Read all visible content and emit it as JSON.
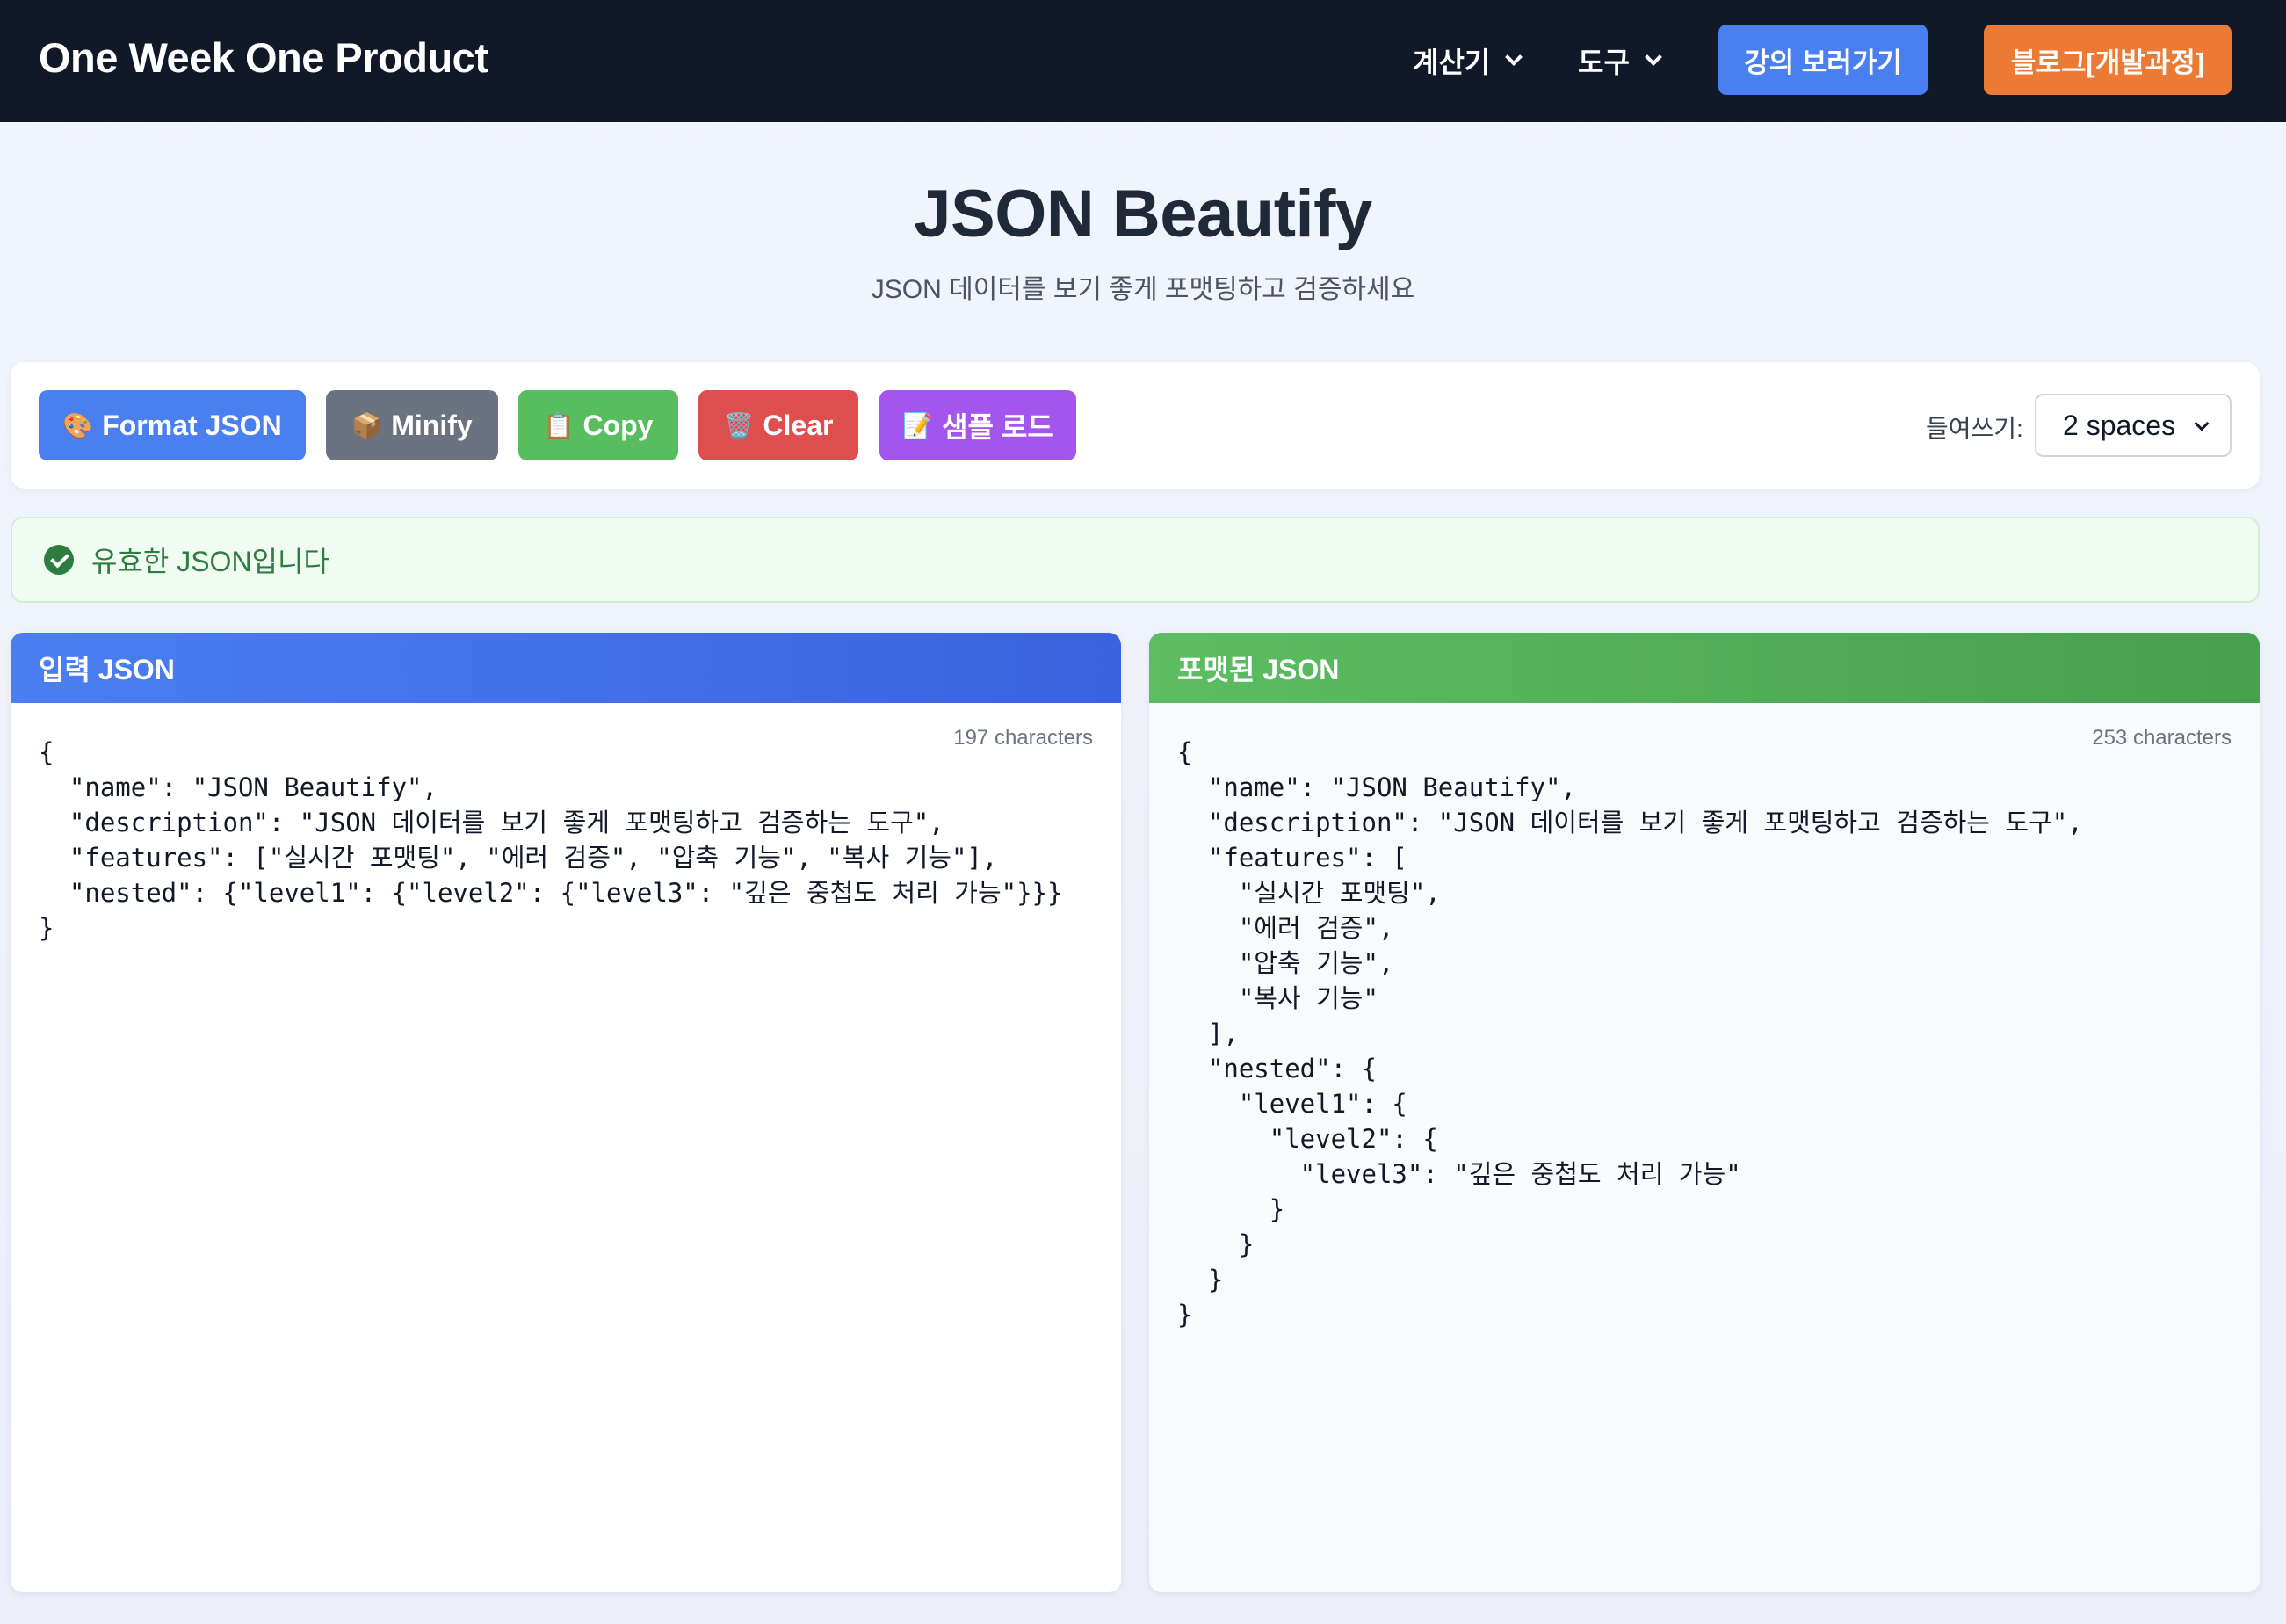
{
  "navbar": {
    "brand": "One Week One Product",
    "menu": [
      {
        "label": "계산기"
      },
      {
        "label": "도구"
      }
    ],
    "lecture_button": "강의 보러가기",
    "blog_button": "블로그[개발과정]"
  },
  "header": {
    "title": "JSON Beautify",
    "subtitle": "JSON 데이터를 보기 좋게 포맷팅하고 검증하세요"
  },
  "toolbar": {
    "buttons": [
      {
        "emoji": "🎨",
        "label": "Format JSON"
      },
      {
        "emoji": "📦",
        "label": "Minify"
      },
      {
        "emoji": "📋",
        "label": "Copy"
      },
      {
        "emoji": "🗑️",
        "label": "Clear"
      },
      {
        "emoji": "📝",
        "label": "샘플 로드"
      }
    ],
    "indent_label": "들여쓰기:",
    "indent_value": "2 spaces"
  },
  "status": {
    "message": "유효한 JSON입니다",
    "color": "#2e7d40"
  },
  "input_panel": {
    "title": "입력 JSON",
    "char_count": "197 characters",
    "content": "{\n  \"name\": \"JSON Beautify\",\n  \"description\": \"JSON 데이터를 보기 좋게 포맷팅하고 검증하는 도구\",\n  \"features\": [\"실시간 포맷팅\", \"에러 검증\", \"압축 기능\", \"복사 기능\"],\n  \"nested\": {\"level1\": {\"level2\": {\"level3\": \"깊은 중첩도 처리 가능\"}}}\n}"
  },
  "output_panel": {
    "title": "포맷된 JSON",
    "char_count": "253 characters",
    "content": "{\n  \"name\": \"JSON Beautify\",\n  \"description\": \"JSON 데이터를 보기 좋게 포맷팅하고 검증하는 도구\",\n  \"features\": [\n    \"실시간 포맷팅\",\n    \"에러 검증\",\n    \"압축 기능\",\n    \"복사 기능\"\n  ],\n  \"nested\": {\n    \"level1\": {\n      \"level2\": {\n        \"level3\": \"깊은 중첩도 처리 가능\"\n      }\n    }\n  }\n}"
  },
  "colors": {
    "navbar_bg": "#111827",
    "primary_blue": "#4a7ff0",
    "gray": "#6b7280",
    "green": "#58bd5f",
    "red": "#df4e4e",
    "purple": "#a455ee",
    "orange": "#ec7a35"
  }
}
